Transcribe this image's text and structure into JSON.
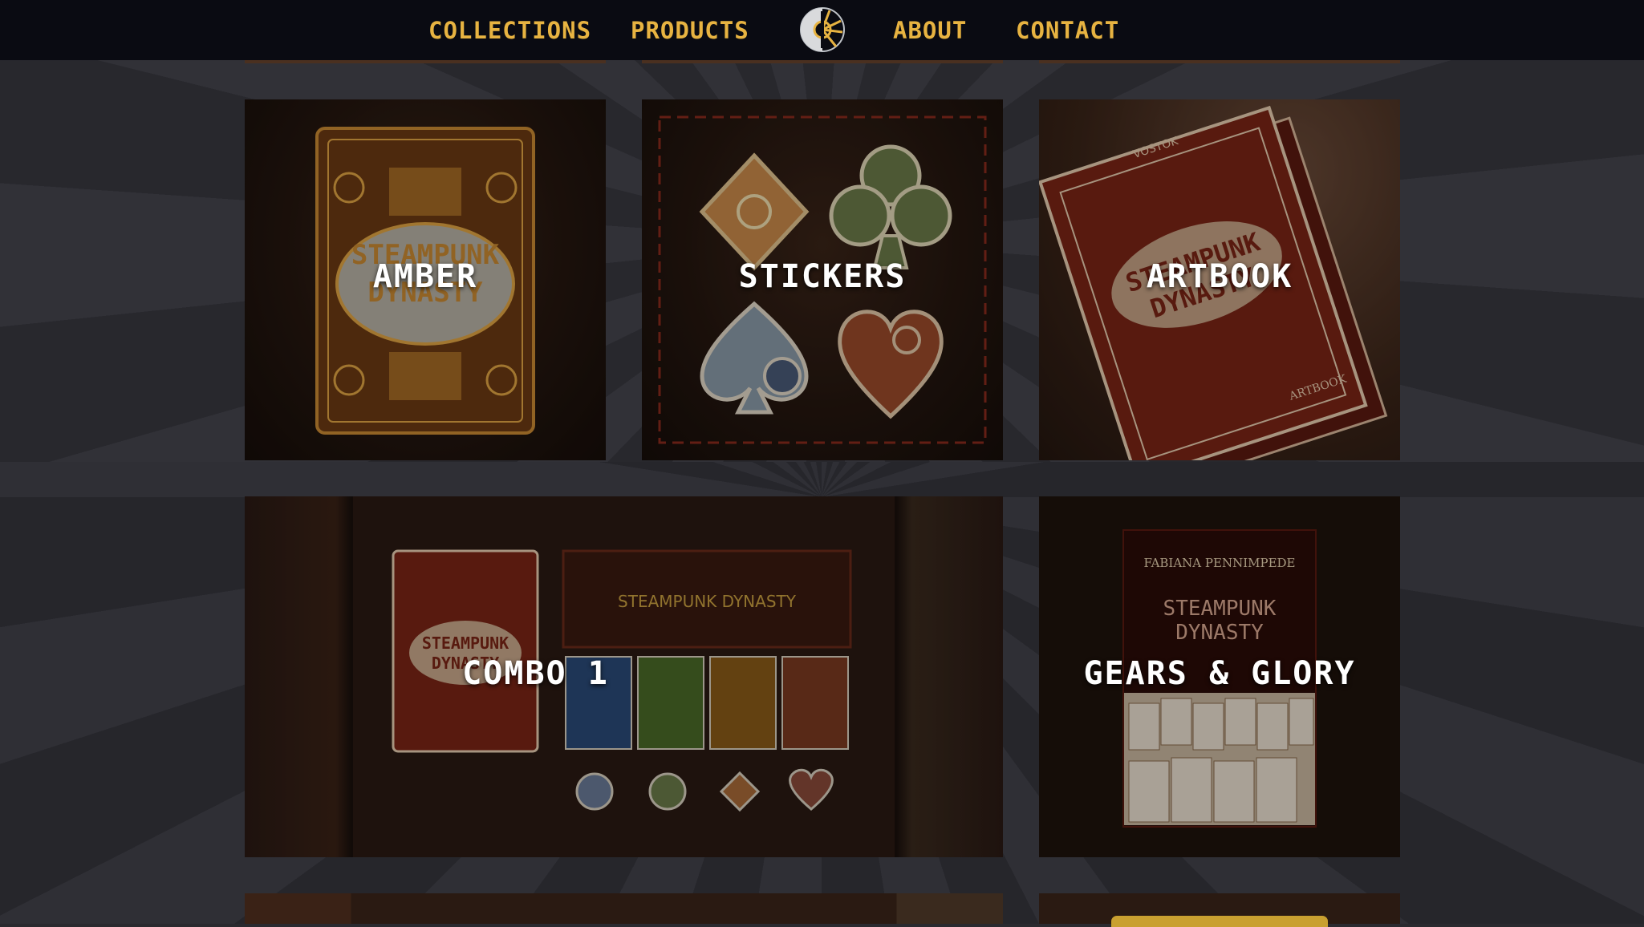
{
  "nav": {
    "items": [
      "COLLECTIONS",
      "PRODUCTS",
      "ABOUT",
      "CONTACT"
    ],
    "logo_icon": "compass-gear-logo-icon",
    "text_color": "#e7b341",
    "background": "#0a0b12"
  },
  "tiles": [
    {
      "label": "AMBER"
    },
    {
      "label": "STICKERS"
    },
    {
      "label": "ARTBOOK"
    },
    {
      "label": "COMBO 1"
    },
    {
      "label": "GEARS & GLORY"
    }
  ],
  "artwork_text": {
    "deck_title_line1": "STEAMPUNK",
    "deck_title_line2": "DYNASTY",
    "box_title": "STEAMPUNK DYNASTY",
    "brand": "VOSTOK",
    "artbook_mark": "ARTBOOK",
    "book_author": "FABIANA PENNIMPEDE",
    "book_title_line1": "STEAMPUNK",
    "book_title_line2": "DYNASTY"
  }
}
